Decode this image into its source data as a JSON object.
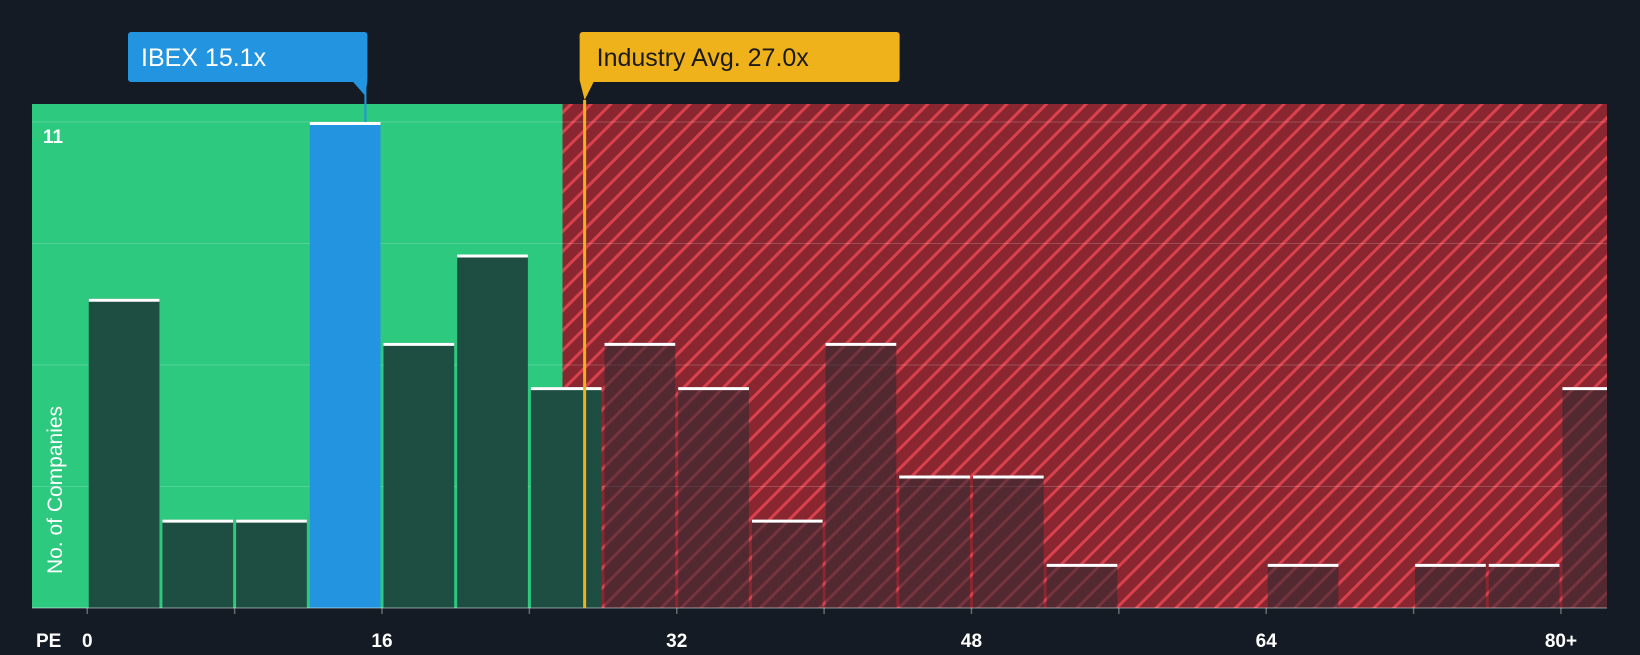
{
  "chart_data": {
    "type": "bar",
    "xlabel": "PE",
    "ylabel": "No. of Companies",
    "x_ticks": [
      "0",
      "16",
      "32",
      "48",
      "64",
      "80+"
    ],
    "x_tick_values": [
      0,
      16,
      32,
      48,
      64,
      80
    ],
    "x_range": [
      -3,
      82.5
    ],
    "ylim": [
      0,
      11
    ],
    "y_top_label": "11",
    "grid": true,
    "bin_width": 4,
    "bins": [
      {
        "start": 0,
        "value": 7
      },
      {
        "start": 4,
        "value": 2
      },
      {
        "start": 8,
        "value": 2
      },
      {
        "start": 12,
        "value": 11,
        "highlight": true
      },
      {
        "start": 16,
        "value": 6
      },
      {
        "start": 20,
        "value": 8
      },
      {
        "start": 24,
        "value": 5
      },
      {
        "start": 28,
        "value": 6
      },
      {
        "start": 32,
        "value": 5
      },
      {
        "start": 36,
        "value": 2
      },
      {
        "start": 40,
        "value": 6
      },
      {
        "start": 44,
        "value": 3
      },
      {
        "start": 48,
        "value": 3
      },
      {
        "start": 52,
        "value": 1
      },
      {
        "start": 56,
        "value": 0
      },
      {
        "start": 60,
        "value": 0
      },
      {
        "start": 64,
        "value": 1
      },
      {
        "start": 68,
        "value": 0
      },
      {
        "start": 72,
        "value": 1
      },
      {
        "start": 76,
        "value": 1
      },
      {
        "start": 80,
        "value": 5
      }
    ],
    "company": {
      "label": "IBEX 15.1x",
      "value": 15.1
    },
    "industry_avg": {
      "label": "Industry Avg. 27.0x",
      "value": 27.0
    },
    "fair_zone_end": 25.8
  },
  "colors": {
    "background": "#151b24",
    "fair_zone": "#2dc97e",
    "overvalued_zone": "#8a2630",
    "hatch": "#d9414d",
    "bar": "#1e4d42",
    "bar_over": "#242a33",
    "highlight_bar": "#2394e0",
    "company_marker": "#2394e0",
    "industry_marker": "#f0b21a",
    "bar_top": "#ffffff",
    "axis_text": "#ffffff"
  }
}
